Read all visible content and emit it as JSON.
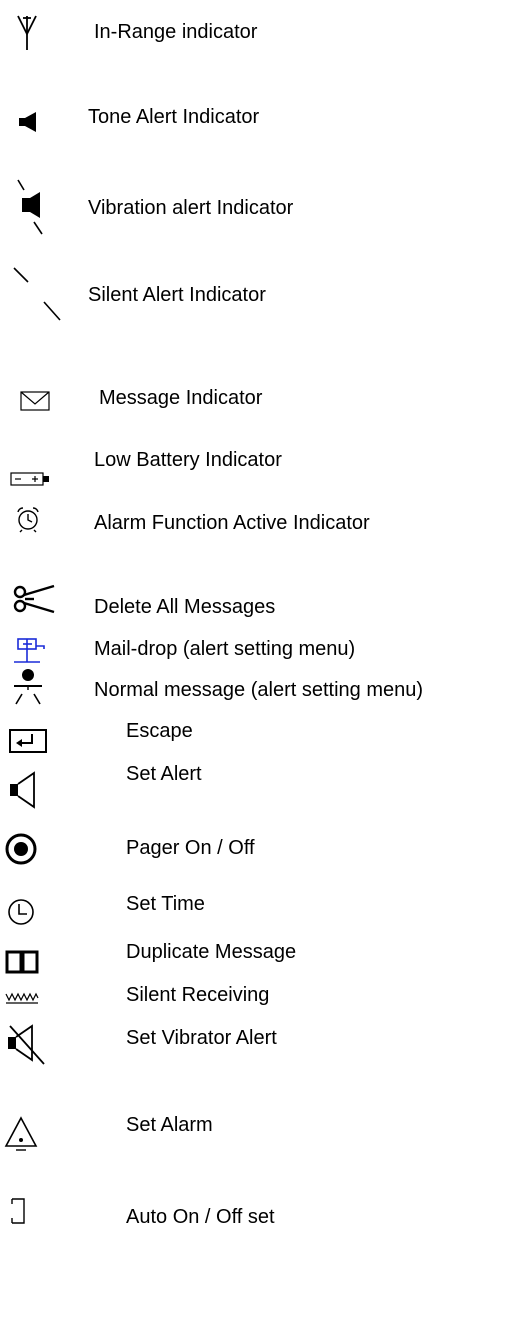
{
  "legend": {
    "items": [
      {
        "icon": "in-range-antenna-icon",
        "label": "In-Range indicator"
      },
      {
        "icon": "tone-alert-speaker-icon",
        "label": "Tone Alert Indicator"
      },
      {
        "icon": "vibration-alert-icon",
        "label": "Vibration alert Indicator"
      },
      {
        "icon": "silent-alert-icon",
        "label": "Silent Alert Indicator"
      },
      {
        "icon": "envelope-icon",
        "label": "Message Indicator"
      },
      {
        "icon": "low-battery-icon",
        "label": "Low Battery Indicator"
      },
      {
        "icon": "alarm-clock-icon",
        "label": "Alarm Function Active Indicator"
      },
      {
        "icon": "scissors-icon",
        "label": "Delete All Messages"
      },
      {
        "icon": "mail-drop-icon",
        "label": "Mail-drop (alert setting menu)"
      },
      {
        "icon": "normal-message-icon",
        "label": "Normal message (alert setting menu)"
      },
      {
        "icon": "escape-return-icon",
        "label": "Escape"
      },
      {
        "icon": "speaker-outline-icon",
        "label": "Set Alert"
      },
      {
        "icon": "power-circle-icon",
        "label": "Pager On / Off"
      },
      {
        "icon": "clock-icon",
        "label": "Set Time"
      },
      {
        "icon": "open-book-icon",
        "label": "Duplicate Message"
      },
      {
        "icon": "zigzag-wave-icon",
        "label": "Silent Receiving"
      },
      {
        "icon": "muted-speaker-icon",
        "label": "Set Vibrator Alert"
      },
      {
        "icon": "bell-triangle-icon",
        "label": "Set Alarm"
      },
      {
        "icon": "bracket-icon",
        "label": "Auto On / Off set"
      }
    ]
  },
  "colors": {
    "text": "#000000",
    "mail_drop_icon": "#1a2bd8"
  }
}
